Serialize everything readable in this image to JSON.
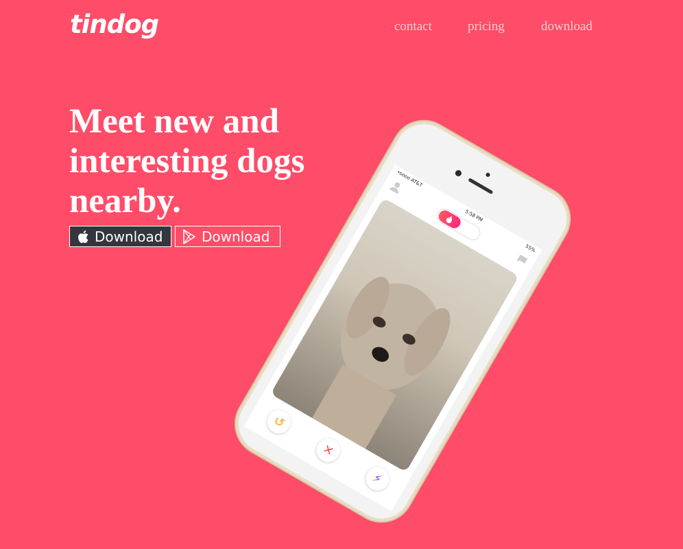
{
  "brand": {
    "name": "tindog"
  },
  "nav": {
    "items": [
      "contact",
      "pricing",
      "download"
    ]
  },
  "hero": {
    "headline": "Meet new and interesting dogs nearby.",
    "ios_button_label": "Download",
    "play_button_label": "Download"
  },
  "phone": {
    "carrier": "•oooo AT&T",
    "time": "5:58 PM",
    "battery": "55%"
  },
  "colors": {
    "background": "#ff4c68",
    "ios_button_bg": "#33363d",
    "accent_gradient_start": "#ff5864",
    "accent_gradient_end": "#fd267d"
  },
  "icons": [
    "apple-icon",
    "google-play-icon",
    "profile-icon",
    "chat-icon",
    "flame-icon",
    "rewind-icon",
    "nope-icon",
    "boost-icon"
  ]
}
